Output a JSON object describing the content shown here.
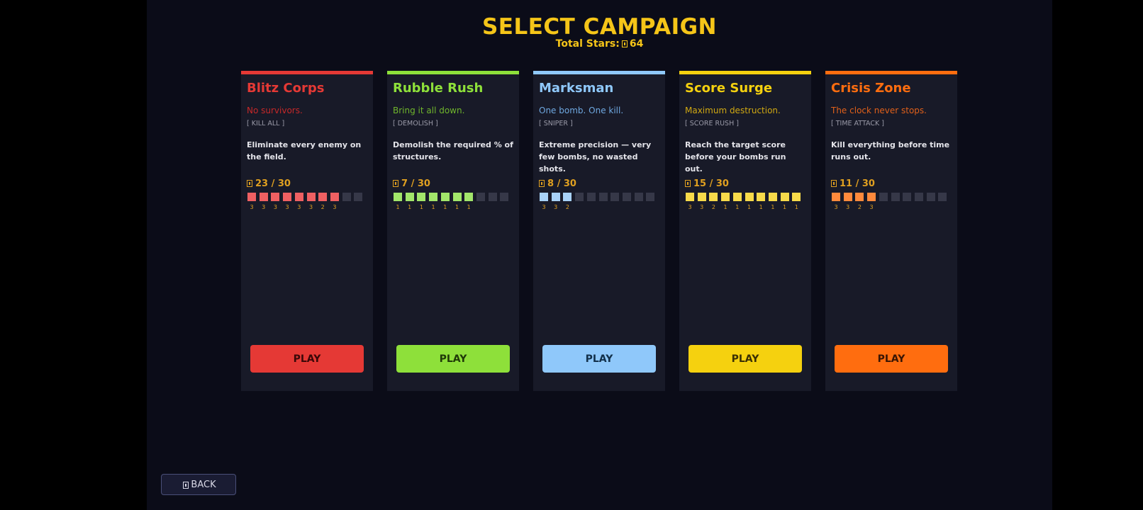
{
  "header": {
    "title": "SELECT CAMPAIGN",
    "total_label": "Total Stars:",
    "total_value": "64",
    "star_icon": "star-icon"
  },
  "back_button": {
    "label": "BACK",
    "icon": "star-icon"
  },
  "campaigns": [
    {
      "name": "Blitz Corps",
      "tagline": "No survivors.",
      "mode": "[ KILL ALL ]",
      "description": "Eliminate every enemy on the field.",
      "stars": "23 / 30",
      "accent": "#e53935",
      "tagline_color": "#c62828",
      "filled_color": "#ef6062",
      "completed": 8,
      "total_levels": 10,
      "level_stars": [
        "3",
        "3",
        "3",
        "3",
        "3",
        "3",
        "2",
        "3"
      ],
      "play_label": "PLAY",
      "play_text_color": "#3a0808"
    },
    {
      "name": "Rubble Rush",
      "tagline": "Bring it all down.",
      "mode": "[ DEMOLISH ]",
      "description": "Demolish the required % of structures.",
      "stars": "7 / 30",
      "accent": "#8ee03a",
      "tagline_color": "#6fb52c",
      "filled_color": "#a2e66a",
      "completed": 7,
      "total_levels": 10,
      "level_stars": [
        "1",
        "1",
        "1",
        "1",
        "1",
        "1",
        "1"
      ],
      "play_label": "PLAY",
      "play_text_color": "#1f3a08"
    },
    {
      "name": "Marksman",
      "tagline": "One bomb. One kill.",
      "mode": "[ SNIPER ]",
      "description": "Extreme precision — very few bombs, no wasted shots.",
      "stars": "8 / 30",
      "accent": "#8fc8fa",
      "tagline_color": "#6fa8e0",
      "filled_color": "#a8d2f8",
      "completed": 3,
      "total_levels": 10,
      "level_stars": [
        "3",
        "3",
        "2"
      ],
      "play_label": "PLAY",
      "play_text_color": "#12304a"
    },
    {
      "name": "Score Surge",
      "tagline": "Maximum destruction.",
      "mode": "[ SCORE RUSH ]",
      "description": "Reach the target score before your bombs run out.",
      "stars": "15 / 30",
      "accent": "#f5d10f",
      "tagline_color": "#d0a812",
      "filled_color": "#f7da4a",
      "completed": 10,
      "total_levels": 10,
      "level_stars": [
        "3",
        "3",
        "2",
        "1",
        "1",
        "1",
        "1",
        "1",
        "1",
        "1"
      ],
      "play_label": "PLAY",
      "play_text_color": "#3a3004"
    },
    {
      "name": "Crisis Zone",
      "tagline": "The clock never stops.",
      "mode": "[ TIME ATTACK ]",
      "description": "Kill everything before time runs out.",
      "stars": "11 / 30",
      "accent": "#ff6d0f",
      "tagline_color": "#e0601a",
      "filled_color": "#ff8a3c",
      "completed": 4,
      "total_levels": 10,
      "level_stars": [
        "3",
        "3",
        "2",
        "3"
      ],
      "play_label": "PLAY",
      "play_text_color": "#3a1504"
    }
  ],
  "colors": {
    "title": "#f5c518",
    "empty_level": "#363848",
    "card_bg": "#181a28",
    "stage_bg": "#0b0c18",
    "level_star_text": "#e0a020"
  }
}
